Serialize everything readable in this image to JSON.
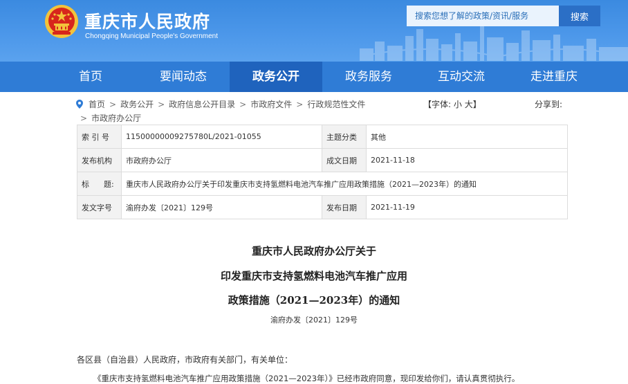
{
  "header": {
    "site_name": "重庆市人民政府",
    "site_name_en": "Chongqing Municipal People's Government",
    "search_placeholder": "搜索您想了解的政策/资讯/服务",
    "search_button": "搜索"
  },
  "nav": {
    "items": [
      {
        "label": "首页"
      },
      {
        "label": "要闻动态"
      },
      {
        "label": "政务公开"
      },
      {
        "label": "政务服务"
      },
      {
        "label": "互动交流"
      },
      {
        "label": "走进重庆"
      }
    ],
    "active_index": 2
  },
  "breadcrumb": {
    "items": [
      "首页",
      "政务公开",
      "政府信息公开目录",
      "市政府文件",
      "行政规范性文件",
      "市政府办公厅"
    ],
    "separator": ">"
  },
  "font_size": {
    "label": "【字体:",
    "small": "小",
    "large": "大",
    "close": "】"
  },
  "share": {
    "label": "分享到:"
  },
  "meta": {
    "index_label": "索 引 号",
    "index_value": "11500000009275780L/2021-01055",
    "category_label": "主题分类",
    "category_value": "其他",
    "publisher_label": "发布机构",
    "publisher_value": "市政府办公厅",
    "created_label": "成文日期",
    "created_value": "2021-11-18",
    "title_label": "标      题:",
    "title_value": "重庆市人民政府办公厅关于印发重庆市支持氢燃料电池汽车推广应用政策措施（2021—2023年）的通知",
    "doc_no_label": "发文字号",
    "doc_no_value": "渝府办发〔2021〕129号",
    "publish_label": "发布日期",
    "publish_value": "2021-11-19"
  },
  "document": {
    "title_line1": "重庆市人民政府办公厅关于",
    "title_line2": "印发重庆市支持氢燃料电池汽车推广应用",
    "title_line3": "政策措施（2021—2023年）的通知",
    "doc_code": "渝府办发〔2021〕129号",
    "salutation": "各区县（自治县）人民政府，市政府有关部门，有关单位：",
    "paragraph1": "《重庆市支持氢燃料电池汽车推广应用政策措施（2021—2023年）》已经市政府同意，现印发给你们，请认真贯彻执行。"
  },
  "colors": {
    "header_blue": "#4d98ea",
    "nav_blue": "#2f7cd6",
    "nav_active": "#1f63bd",
    "emblem_red": "#d7261c",
    "emblem_gold": "#f3c33b"
  }
}
